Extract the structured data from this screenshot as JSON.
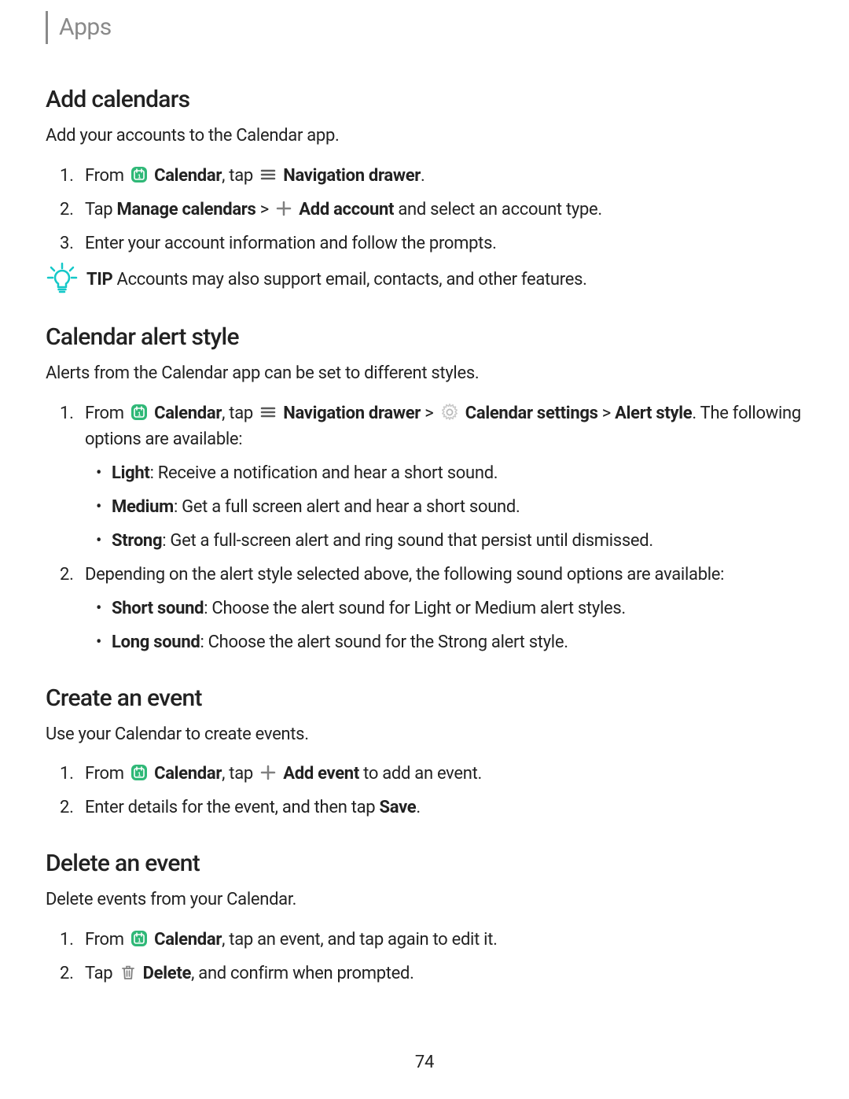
{
  "header": {
    "title": "Apps"
  },
  "s1": {
    "heading": "Add calendars",
    "intro": "Add your accounts to the Calendar app.",
    "step1": {
      "t1": "From ",
      "cal": "Calendar",
      "t2": ", tap ",
      "nav": "Navigation drawer",
      "t3": "."
    },
    "step2": {
      "t1": "Tap ",
      "mc": "Manage calendars",
      "t2": " > ",
      "add": "Add account",
      "t3": " and select an account type."
    },
    "step3": "Enter your account information and follow the prompts.",
    "tip": {
      "label": "TIP",
      "text": " Accounts may also support email, contacts, and other features."
    }
  },
  "s2": {
    "heading": "Calendar alert style",
    "intro": "Alerts from the Calendar app can be set to different styles.",
    "step1": {
      "t1": "From ",
      "cal": "Calendar",
      "t2": ", tap ",
      "nav": "Navigation drawer",
      "t3": " > ",
      "cs": "Calendar settings",
      "t4": " > ",
      "as": "Alert style",
      "t5": ". The following options are available:"
    },
    "b1": {
      "k": "Light",
      "v": ": Receive a notification and hear a short sound."
    },
    "b2": {
      "k": "Medium",
      "v": ": Get a full screen alert and hear a short sound."
    },
    "b3": {
      "k": "Strong",
      "v": ": Get a full-screen alert and ring sound that persist until dismissed."
    },
    "step2": "Depending on the alert style selected above, the following sound options are available:",
    "b4": {
      "k": "Short sound",
      "v": ": Choose the alert sound for Light or Medium alert styles."
    },
    "b5": {
      "k": "Long sound",
      "v": ": Choose the alert sound for the Strong alert style."
    }
  },
  "s3": {
    "heading": "Create an event",
    "intro": "Use your Calendar to create events.",
    "step1": {
      "t1": "From ",
      "cal": "Calendar",
      "t2": ", tap ",
      "add": "Add event",
      "t3": " to add an event."
    },
    "step2": {
      "t1": "Enter details for the event, and then tap ",
      "save": "Save",
      "t2": "."
    }
  },
  "s4": {
    "heading": "Delete an event",
    "intro": "Delete events from your Calendar.",
    "step1": {
      "t1": "From ",
      "cal": "Calendar",
      "t2": ", tap an event, and tap again to edit it."
    },
    "step2": {
      "t1": "Tap ",
      "del": "Delete",
      "t2": ", and confirm when prompted."
    }
  },
  "page": "74"
}
